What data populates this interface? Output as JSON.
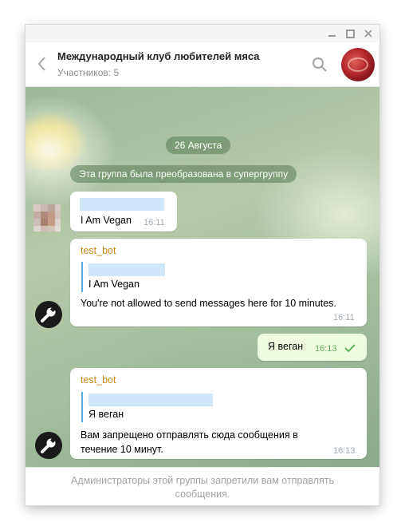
{
  "header": {
    "title": "Международный клуб любителей мяса",
    "subtitle": "Участников: 5"
  },
  "chat": {
    "date_label": "26 Августа",
    "service_message": "Эта группа была преобразована в супергруппу",
    "messages": [
      {
        "direction": "incoming",
        "sender": "",
        "text": "I Am Vegan",
        "time": "16:11"
      },
      {
        "direction": "incoming",
        "sender": "test_bot",
        "reply_text": "I Am Vegan",
        "text": "You're not allowed to send messages here for 10 minutes.",
        "time": "16:11"
      },
      {
        "direction": "outgoing",
        "text": "Я веган",
        "time": "16:13",
        "status": "read"
      },
      {
        "direction": "incoming",
        "sender": "test_bot",
        "reply_text": "Я веган",
        "text": "Вам запрещено отправлять сюда сообщения в течение 10 минут.",
        "time": "16:13"
      }
    ]
  },
  "footer": {
    "notice": "Администраторы этой группы запретили вам отправлять сообщения."
  },
  "colors": {
    "sender_name": "#c98a16",
    "reply_bar": "#5aa8e0",
    "outgoing_bubble": "#effdde",
    "read_check": "#4fae4e"
  },
  "icons": [
    "minimize-icon",
    "maximize-icon",
    "close-icon",
    "back-arrow-icon",
    "search-icon",
    "wrench-icon",
    "double-check-icon"
  ]
}
